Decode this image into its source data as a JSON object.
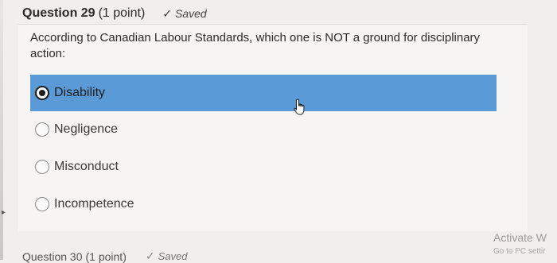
{
  "question": {
    "title": "Question 29",
    "points": "(1 point)",
    "saved_label": "Saved",
    "prompt": "According to Canadian Labour Standards, which one is NOT a ground for disciplinary action:",
    "options": [
      {
        "label": "Disability",
        "selected": true
      },
      {
        "label": "Negligence",
        "selected": false
      },
      {
        "label": "Misconduct",
        "selected": false
      },
      {
        "label": "Incompetence",
        "selected": false
      }
    ]
  },
  "next_question": {
    "title": "Question 30",
    "points": "(1 point)",
    "saved_label": "Saved"
  },
  "activation": {
    "title": "Activate W",
    "subtitle": "Go to PC settir"
  },
  "colors": {
    "selected_option_bg": "#5a9ad6",
    "page_bg": "#f0efed"
  },
  "icons": {
    "saved": "checkmark-icon",
    "cursor": "hand-pointer-icon",
    "selected_radio": "radio-selected-icon",
    "unselected_radio": "radio-unselected-icon"
  }
}
